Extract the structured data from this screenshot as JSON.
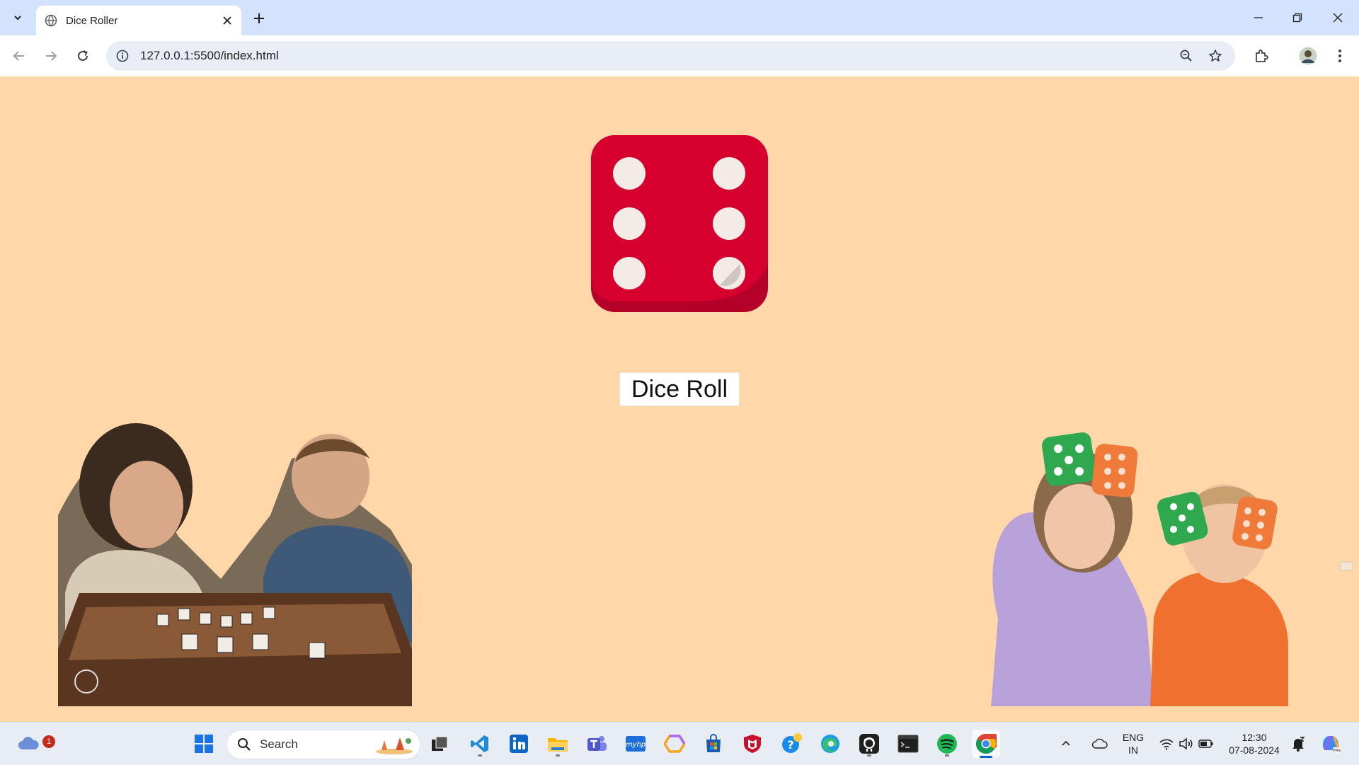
{
  "browser": {
    "tab_title": "Dice Roller",
    "url": "127.0.0.1:5500/index.html"
  },
  "page": {
    "button_label": "Dice Roll",
    "dice_face_value": 6,
    "dice_color": "#d6002f",
    "background_color": "#ffd7a8"
  },
  "taskbar": {
    "search_label": "Search",
    "weather_badge": "1",
    "language_line1": "ENG",
    "language_line2": "IN",
    "time": "12:30",
    "date": "07-08-2024"
  }
}
